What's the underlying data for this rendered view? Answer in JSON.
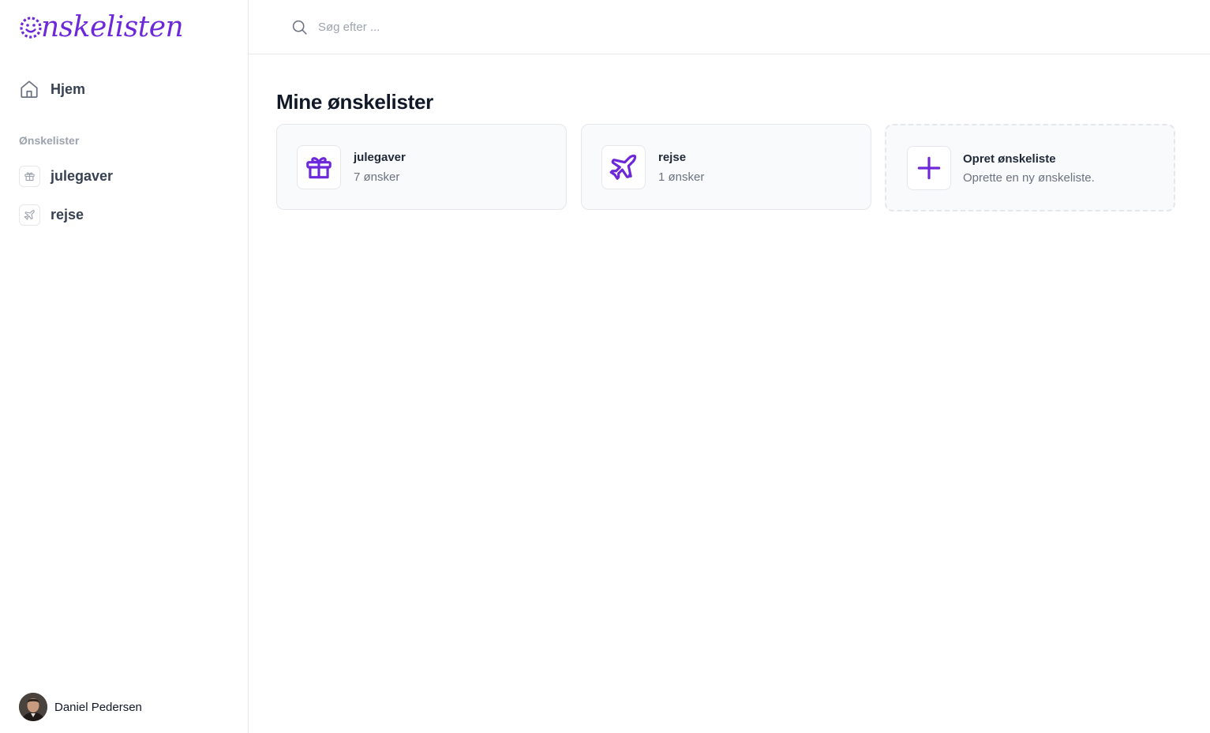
{
  "app": {
    "logo_text": "nskelisten",
    "accent_color": "#6d28d9"
  },
  "sidebar": {
    "home_label": "Hjem",
    "section_label": "Ønskelister",
    "items": [
      {
        "label": "julegaver",
        "icon": "gift-icon"
      },
      {
        "label": "rejse",
        "icon": "plane-icon"
      }
    ]
  },
  "user": {
    "name": "Daniel Pedersen"
  },
  "search": {
    "placeholder": "Søg efter ...",
    "value": ""
  },
  "main": {
    "title": "Mine ønskelister",
    "cards": [
      {
        "title": "julegaver",
        "subtitle": "7 ønsker",
        "icon": "gift-icon"
      },
      {
        "title": "rejse",
        "subtitle": "1 ønsker",
        "icon": "plane-icon"
      }
    ],
    "create_card": {
      "title": "Opret ønskeliste",
      "subtitle": "Oprette en ny ønskeliste.",
      "icon": "plus-icon"
    }
  }
}
